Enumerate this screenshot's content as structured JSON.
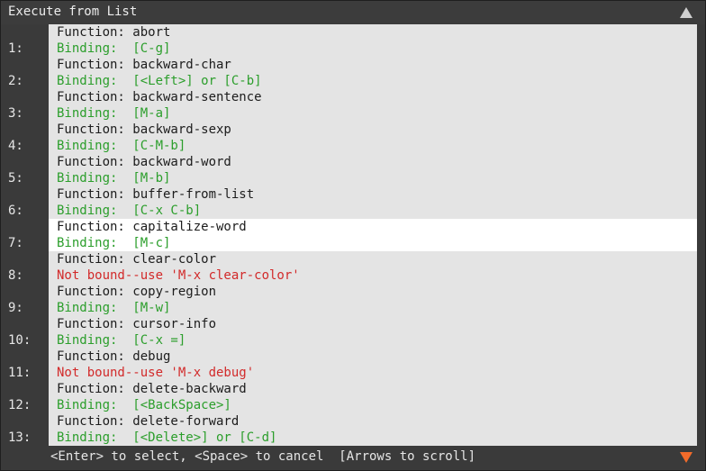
{
  "window": {
    "title": "Execute from List"
  },
  "icons": {
    "scroll_up": "triangle-up-icon",
    "scroll_down": "triangle-down-icon",
    "scroll_down_color": "#f26b2a"
  },
  "items": [
    {
      "num": "1:",
      "fn": "Function: abort",
      "bind": "Binding:  [C-g]",
      "bound": true,
      "selected": false
    },
    {
      "num": "2:",
      "fn": "Function: backward-char",
      "bind": "Binding:  [<Left>] or [C-b]",
      "bound": true,
      "selected": false
    },
    {
      "num": "3:",
      "fn": "Function: backward-sentence",
      "bind": "Binding:  [M-a]",
      "bound": true,
      "selected": false
    },
    {
      "num": "4:",
      "fn": "Function: backward-sexp",
      "bind": "Binding:  [C-M-b]",
      "bound": true,
      "selected": false
    },
    {
      "num": "5:",
      "fn": "Function: backward-word",
      "bind": "Binding:  [M-b]",
      "bound": true,
      "selected": false
    },
    {
      "num": "6:",
      "fn": "Function: buffer-from-list",
      "bind": "Binding:  [C-x C-b]",
      "bound": true,
      "selected": false
    },
    {
      "num": "7:",
      "fn": "Function: capitalize-word",
      "bind": "Binding:  [M-c]",
      "bound": true,
      "selected": true
    },
    {
      "num": "8:",
      "fn": "Function: clear-color",
      "bind": "Not bound--use 'M-x clear-color'",
      "bound": false,
      "selected": false
    },
    {
      "num": "9:",
      "fn": "Function: copy-region",
      "bind": "Binding:  [M-w]",
      "bound": true,
      "selected": false
    },
    {
      "num": "10:",
      "fn": "Function: cursor-info",
      "bind": "Binding:  [C-x =]",
      "bound": true,
      "selected": false
    },
    {
      "num": "11:",
      "fn": "Function: debug",
      "bind": "Not bound--use 'M-x debug'",
      "bound": false,
      "selected": false
    },
    {
      "num": "12:",
      "fn": "Function: delete-backward",
      "bind": "Binding:  [<BackSpace>]",
      "bound": true,
      "selected": false
    },
    {
      "num": "13:",
      "fn": "Function: delete-forward",
      "bind": "Binding:  [<Delete>] or [C-d]",
      "bound": true,
      "selected": false
    }
  ],
  "footer": {
    "hint": "<Enter> to select, <Space> to cancel  [Arrows to scroll]"
  }
}
